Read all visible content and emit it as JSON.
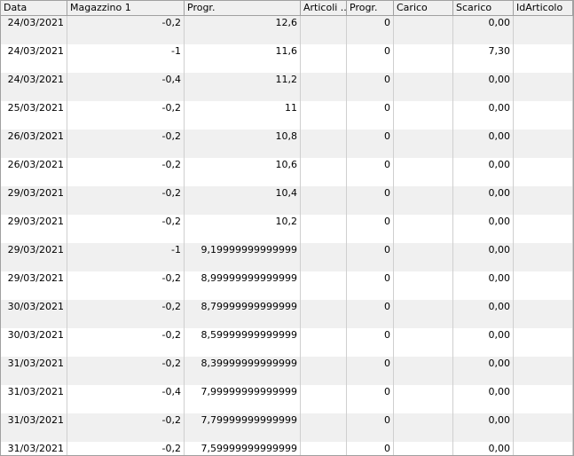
{
  "columns": [
    "Data",
    "Magazzino 1",
    "Progr.",
    "Articoli ...",
    "Progr.",
    "Carico",
    "Scarico",
    "IdArticolo"
  ],
  "rows": [
    {
      "data": "24/03/2021",
      "magazzino": "-0,2",
      "progr": "12,6",
      "articoli": "",
      "progr2": "0",
      "carico": "",
      "scarico": "0,00",
      "idarticolo": ""
    },
    {
      "data": "24/03/2021",
      "magazzino": "-1",
      "progr": "11,6",
      "articoli": "",
      "progr2": "0",
      "carico": "",
      "scarico": "7,30",
      "idarticolo": ""
    },
    {
      "data": "24/03/2021",
      "magazzino": "-0,4",
      "progr": "11,2",
      "articoli": "",
      "progr2": "0",
      "carico": "",
      "scarico": "0,00",
      "idarticolo": ""
    },
    {
      "data": "25/03/2021",
      "magazzino": "-0,2",
      "progr": "11",
      "articoli": "",
      "progr2": "0",
      "carico": "",
      "scarico": "0,00",
      "idarticolo": ""
    },
    {
      "data": "26/03/2021",
      "magazzino": "-0,2",
      "progr": "10,8",
      "articoli": "",
      "progr2": "0",
      "carico": "",
      "scarico": "0,00",
      "idarticolo": ""
    },
    {
      "data": "26/03/2021",
      "magazzino": "-0,2",
      "progr": "10,6",
      "articoli": "",
      "progr2": "0",
      "carico": "",
      "scarico": "0,00",
      "idarticolo": ""
    },
    {
      "data": "29/03/2021",
      "magazzino": "-0,2",
      "progr": "10,4",
      "articoli": "",
      "progr2": "0",
      "carico": "",
      "scarico": "0,00",
      "idarticolo": ""
    },
    {
      "data": "29/03/2021",
      "magazzino": "-0,2",
      "progr": "10,2",
      "articoli": "",
      "progr2": "0",
      "carico": "",
      "scarico": "0,00",
      "idarticolo": ""
    },
    {
      "data": "29/03/2021",
      "magazzino": "-1",
      "progr": "9,19999999999999",
      "articoli": "",
      "progr2": "0",
      "carico": "",
      "scarico": "0,00",
      "idarticolo": ""
    },
    {
      "data": "29/03/2021",
      "magazzino": "-0,2",
      "progr": "8,99999999999999",
      "articoli": "",
      "progr2": "0",
      "carico": "",
      "scarico": "0,00",
      "idarticolo": ""
    },
    {
      "data": "30/03/2021",
      "magazzino": "-0,2",
      "progr": "8,79999999999999",
      "articoli": "",
      "progr2": "0",
      "carico": "",
      "scarico": "0,00",
      "idarticolo": ""
    },
    {
      "data": "30/03/2021",
      "magazzino": "-0,2",
      "progr": "8,59999999999999",
      "articoli": "",
      "progr2": "0",
      "carico": "",
      "scarico": "0,00",
      "idarticolo": ""
    },
    {
      "data": "31/03/2021",
      "magazzino": "-0,2",
      "progr": "8,39999999999999",
      "articoli": "",
      "progr2": "0",
      "carico": "",
      "scarico": "0,00",
      "idarticolo": ""
    },
    {
      "data": "31/03/2021",
      "magazzino": "-0,4",
      "progr": "7,99999999999999",
      "articoli": "",
      "progr2": "0",
      "carico": "",
      "scarico": "0,00",
      "idarticolo": ""
    },
    {
      "data": "31/03/2021",
      "magazzino": "-0,2",
      "progr": "7,79999999999999",
      "articoli": "",
      "progr2": "0",
      "carico": "",
      "scarico": "0,00",
      "idarticolo": ""
    },
    {
      "data": "31/03/2021",
      "magazzino": "-0,2",
      "progr": "7,59999999999999",
      "articoli": "",
      "progr2": "0",
      "carico": "",
      "scarico": "0,00",
      "idarticolo": ""
    }
  ]
}
